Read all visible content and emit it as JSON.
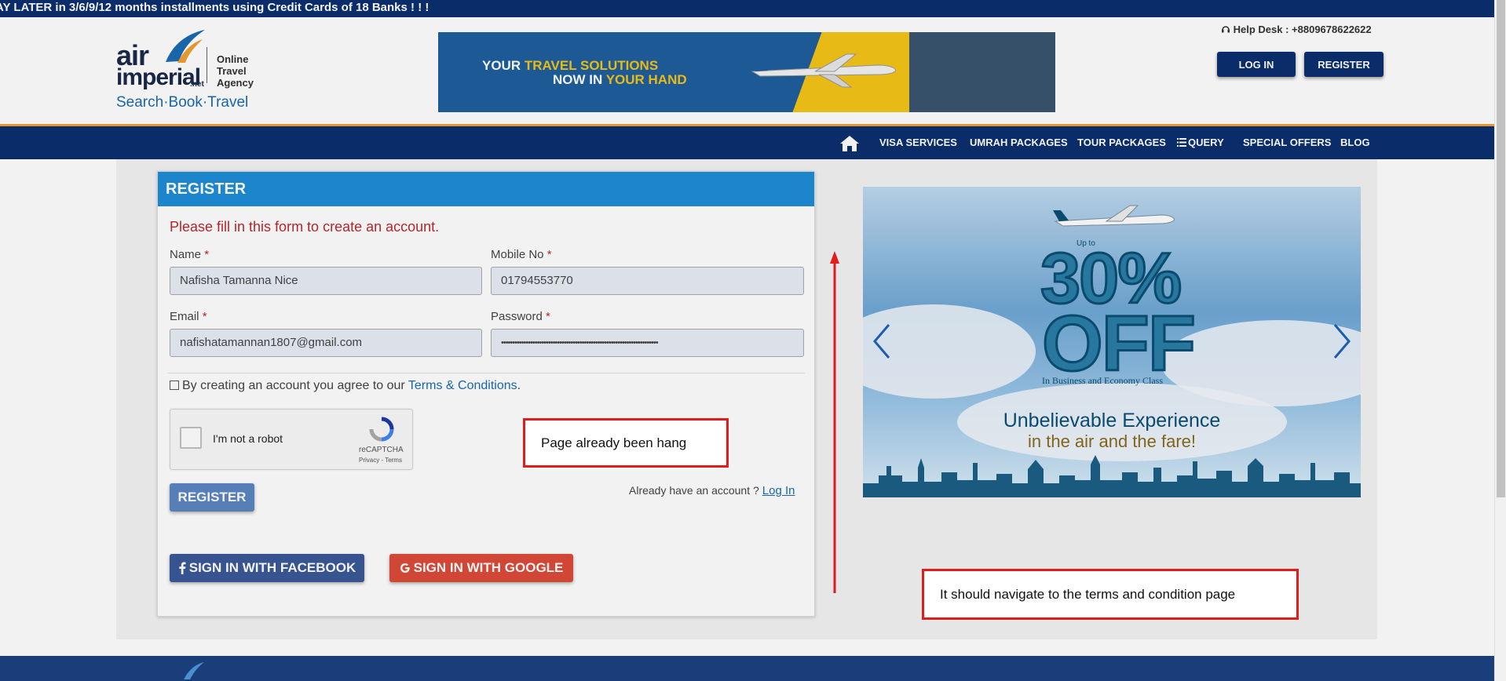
{
  "marquee": {
    "text": "AY LATER in 3/6/9/12 months installments using Credit Cards of 18 Banks ! ! !"
  },
  "logo": {
    "air": "air",
    "imperial": "imperial",
    "net": ".net",
    "agency": [
      "Online",
      "Travel",
      "Agency"
    ],
    "tagline": "Search·Book·Travel"
  },
  "banner": {
    "line1_a": "YOUR ",
    "line1_b": "TRAVEL SOLUTIONS",
    "line2_a": "NOW IN ",
    "line2_b": "YOUR HAND"
  },
  "header": {
    "helpdesk": "Help Desk : +8809678622622",
    "login_label": "LOG IN",
    "register_label": "REGISTER"
  },
  "nav": {
    "items": [
      "VISA SERVICES",
      "UMRAH PACKAGES",
      "TOUR PACKAGES",
      "QUERY",
      "SPECIAL OFFERS",
      "BLOG"
    ]
  },
  "form": {
    "title": "REGISTER",
    "subtitle": "Please fill in this form to create an account.",
    "name_label": "Name",
    "name_value": "Nafisha Tamanna Nice",
    "mobile_label": "Mobile No",
    "mobile_value": "01794553770",
    "email_label": "Email",
    "email_value": "nafishatamannan1807@gmail.com",
    "password_label": "Password",
    "password_value": "••••••••••••••••••••••••••••••••••••••••••••••••••••••••••••••••••••••",
    "required_mark": "*",
    "agree_text": "By creating an account you agree to our ",
    "terms_link": "Terms & Conditions",
    "agree_end": ".",
    "captcha_text": "I'm not a robot",
    "captcha_brand": "reCAPTCHA",
    "captcha_links": "Privacy - Terms",
    "register_button": "REGISTER",
    "already_text": "Already have an account ?",
    "login_link": "Log In",
    "facebook_button": "SIGN IN WITH FACEBOOK",
    "google_button": "SIGN IN WITH GOOGLE"
  },
  "promo": {
    "upto": "Up to",
    "percent": "30%",
    "off": "OFF",
    "classes": "In Business and Economy Class",
    "headline": "Unbelievable Experience",
    "subline": "in the air and the fare!"
  },
  "annotations": {
    "note1": "Page already been hang",
    "note2": "It should navigate to the terms and condition page",
    "color": "#e21b1b"
  },
  "colors": {
    "brand_navy": "#0b2f6e",
    "accent_orange": "#f0a030",
    "form_header": "#1f8dd6",
    "error_red": "#c0282c",
    "facebook": "#3b5998",
    "google": "#dd4b39"
  }
}
